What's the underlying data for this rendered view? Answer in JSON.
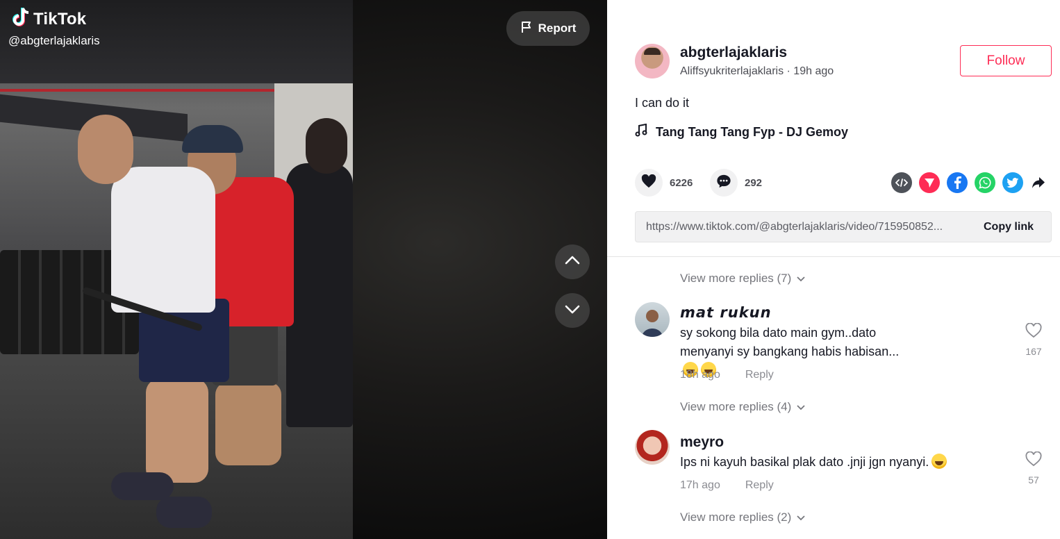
{
  "brand": {
    "name": "TikTok",
    "handle": "@abgterlajaklaris"
  },
  "video": {
    "report_label": "Report"
  },
  "author": {
    "username": "abgterlajaklaris",
    "nickname": "Aliffsyukriterlajaklaris",
    "separator": " · ",
    "posted": "19h ago",
    "follow_label": "Follow"
  },
  "post": {
    "description": "I can do it",
    "music": "Tang Tang Tang Fyp - DJ Gemoy",
    "likes": "6226",
    "comments": "292",
    "link": "https://www.tiktok.com/@abgterlajaklaris/video/715950852...",
    "copy_label": "Copy link"
  },
  "share_icons": [
    "embed-icon",
    "send-to-friends-icon",
    "facebook-icon",
    "whatsapp-icon",
    "twitter-icon",
    "more-share-icon"
  ],
  "colors": {
    "accent": "#fe2c55",
    "embed": "#4e5259",
    "send": "#fe2c55",
    "facebook": "#1877f2",
    "whatsapp": "#25d366",
    "twitter": "#1da1f2"
  },
  "comments": {
    "more_replies_1": "View more replies (7)",
    "c1": {
      "name": "𝙢𝙖𝙩 𝙧𝙪𝙠𝙪𝙣",
      "text": "sy sokong bila dato main gym..dato menyanyi sy bangkang habis habisan...",
      "time": "18h ago",
      "reply": "Reply",
      "likes": "167"
    },
    "more_replies_2": "View more replies (4)",
    "c2": {
      "name": "meyro",
      "text": "Ips ni kayuh basikal plak dato .jnji jgn nyanyi.",
      "time": "17h ago",
      "reply": "Reply",
      "likes": "57"
    },
    "more_replies_3": "View more replies (2)"
  }
}
